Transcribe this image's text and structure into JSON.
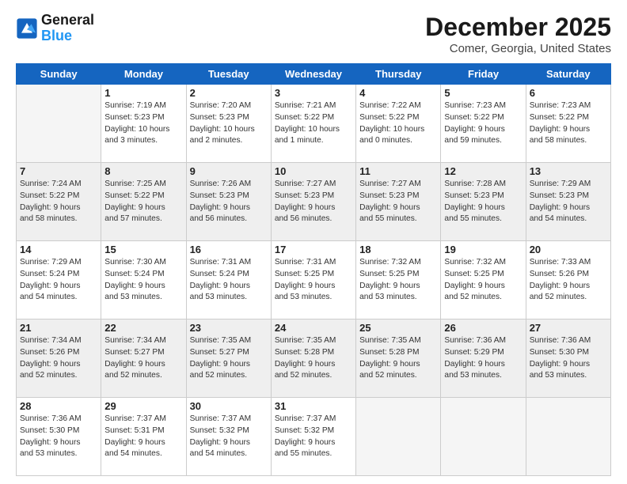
{
  "header": {
    "logo_line1": "General",
    "logo_line2": "Blue",
    "month": "December 2025",
    "location": "Comer, Georgia, United States"
  },
  "weekdays": [
    "Sunday",
    "Monday",
    "Tuesday",
    "Wednesday",
    "Thursday",
    "Friday",
    "Saturday"
  ],
  "weeks": [
    [
      {
        "day": "",
        "content": ""
      },
      {
        "day": "1",
        "content": "Sunrise: 7:19 AM\nSunset: 5:23 PM\nDaylight: 10 hours\nand 3 minutes."
      },
      {
        "day": "2",
        "content": "Sunrise: 7:20 AM\nSunset: 5:23 PM\nDaylight: 10 hours\nand 2 minutes."
      },
      {
        "day": "3",
        "content": "Sunrise: 7:21 AM\nSunset: 5:22 PM\nDaylight: 10 hours\nand 1 minute."
      },
      {
        "day": "4",
        "content": "Sunrise: 7:22 AM\nSunset: 5:22 PM\nDaylight: 10 hours\nand 0 minutes."
      },
      {
        "day": "5",
        "content": "Sunrise: 7:23 AM\nSunset: 5:22 PM\nDaylight: 9 hours\nand 59 minutes."
      },
      {
        "day": "6",
        "content": "Sunrise: 7:23 AM\nSunset: 5:22 PM\nDaylight: 9 hours\nand 58 minutes."
      }
    ],
    [
      {
        "day": "7",
        "content": "Sunrise: 7:24 AM\nSunset: 5:22 PM\nDaylight: 9 hours\nand 58 minutes."
      },
      {
        "day": "8",
        "content": "Sunrise: 7:25 AM\nSunset: 5:22 PM\nDaylight: 9 hours\nand 57 minutes."
      },
      {
        "day": "9",
        "content": "Sunrise: 7:26 AM\nSunset: 5:23 PM\nDaylight: 9 hours\nand 56 minutes."
      },
      {
        "day": "10",
        "content": "Sunrise: 7:27 AM\nSunset: 5:23 PM\nDaylight: 9 hours\nand 56 minutes."
      },
      {
        "day": "11",
        "content": "Sunrise: 7:27 AM\nSunset: 5:23 PM\nDaylight: 9 hours\nand 55 minutes."
      },
      {
        "day": "12",
        "content": "Sunrise: 7:28 AM\nSunset: 5:23 PM\nDaylight: 9 hours\nand 55 minutes."
      },
      {
        "day": "13",
        "content": "Sunrise: 7:29 AM\nSunset: 5:23 PM\nDaylight: 9 hours\nand 54 minutes."
      }
    ],
    [
      {
        "day": "14",
        "content": "Sunrise: 7:29 AM\nSunset: 5:24 PM\nDaylight: 9 hours\nand 54 minutes."
      },
      {
        "day": "15",
        "content": "Sunrise: 7:30 AM\nSunset: 5:24 PM\nDaylight: 9 hours\nand 53 minutes."
      },
      {
        "day": "16",
        "content": "Sunrise: 7:31 AM\nSunset: 5:24 PM\nDaylight: 9 hours\nand 53 minutes."
      },
      {
        "day": "17",
        "content": "Sunrise: 7:31 AM\nSunset: 5:25 PM\nDaylight: 9 hours\nand 53 minutes."
      },
      {
        "day": "18",
        "content": "Sunrise: 7:32 AM\nSunset: 5:25 PM\nDaylight: 9 hours\nand 53 minutes."
      },
      {
        "day": "19",
        "content": "Sunrise: 7:32 AM\nSunset: 5:25 PM\nDaylight: 9 hours\nand 52 minutes."
      },
      {
        "day": "20",
        "content": "Sunrise: 7:33 AM\nSunset: 5:26 PM\nDaylight: 9 hours\nand 52 minutes."
      }
    ],
    [
      {
        "day": "21",
        "content": "Sunrise: 7:34 AM\nSunset: 5:26 PM\nDaylight: 9 hours\nand 52 minutes."
      },
      {
        "day": "22",
        "content": "Sunrise: 7:34 AM\nSunset: 5:27 PM\nDaylight: 9 hours\nand 52 minutes."
      },
      {
        "day": "23",
        "content": "Sunrise: 7:35 AM\nSunset: 5:27 PM\nDaylight: 9 hours\nand 52 minutes."
      },
      {
        "day": "24",
        "content": "Sunrise: 7:35 AM\nSunset: 5:28 PM\nDaylight: 9 hours\nand 52 minutes."
      },
      {
        "day": "25",
        "content": "Sunrise: 7:35 AM\nSunset: 5:28 PM\nDaylight: 9 hours\nand 52 minutes."
      },
      {
        "day": "26",
        "content": "Sunrise: 7:36 AM\nSunset: 5:29 PM\nDaylight: 9 hours\nand 53 minutes."
      },
      {
        "day": "27",
        "content": "Sunrise: 7:36 AM\nSunset: 5:30 PM\nDaylight: 9 hours\nand 53 minutes."
      }
    ],
    [
      {
        "day": "28",
        "content": "Sunrise: 7:36 AM\nSunset: 5:30 PM\nDaylight: 9 hours\nand 53 minutes."
      },
      {
        "day": "29",
        "content": "Sunrise: 7:37 AM\nSunset: 5:31 PM\nDaylight: 9 hours\nand 54 minutes."
      },
      {
        "day": "30",
        "content": "Sunrise: 7:37 AM\nSunset: 5:32 PM\nDaylight: 9 hours\nand 54 minutes."
      },
      {
        "day": "31",
        "content": "Sunrise: 7:37 AM\nSunset: 5:32 PM\nDaylight: 9 hours\nand 55 minutes."
      },
      {
        "day": "",
        "content": ""
      },
      {
        "day": "",
        "content": ""
      },
      {
        "day": "",
        "content": ""
      }
    ]
  ]
}
